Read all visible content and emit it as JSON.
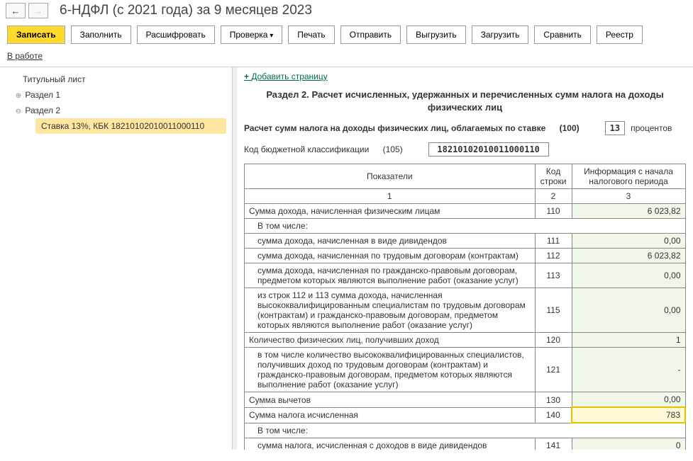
{
  "nav": {
    "back": "←",
    "forward": "→"
  },
  "title": "6-НДФЛ (с 2021 года) за 9 месяцев 2023",
  "toolbar": {
    "save": "Записать",
    "fill": "Заполнить",
    "decode": "Расшифровать",
    "check": "Проверка",
    "print": "Печать",
    "send": "Отправить",
    "export": "Выгрузить",
    "import": "Загрузить",
    "compare": "Сравнить",
    "registry": "Реестр"
  },
  "status": "В работе",
  "tree": {
    "title_page": "Титульный лист",
    "section1": "Раздел 1",
    "section2": "Раздел 2",
    "selected": "Ставка 13%, КБК 18210102010011000110"
  },
  "right": {
    "add_page": "Добавить страницу",
    "heading": "Раздел 2. Расчет исчисленных, удержанных и перечисленных сумм налога на доходы физических лиц",
    "calc_line": "Расчет сумм налога на доходы физических лиц, облагаемых по ставке",
    "calc_code": "(100)",
    "rate": "13",
    "percent_word": "процентов",
    "kbk_label": "Код бюджетной классификации",
    "kbk_code": "(105)",
    "kbk_value": "18210102010011000110",
    "headers": {
      "indicator": "Показатели",
      "code": "Код строки",
      "info": "Информация с начала налогового периода",
      "c1": "1",
      "c2": "2",
      "c3": "3"
    },
    "rows": [
      {
        "label": "Сумма дохода, начисленная физическим лицам",
        "code": "110",
        "val": "6 023,82"
      },
      {
        "label": "В том числе:",
        "sub": true
      },
      {
        "label": "сумма дохода, начисленная в виде дивидендов",
        "code": "111",
        "val": "0,00",
        "indent": true
      },
      {
        "label": "сумма дохода, начисленная по трудовым договорам (контрактам)",
        "code": "112",
        "val": "6 023,82",
        "indent": true
      },
      {
        "label": "сумма дохода, начисленная по гражданско-правовым договорам, предметом которых являются выполнение работ (оказание услуг)",
        "code": "113",
        "val": "0,00",
        "indent": true
      },
      {
        "label": "из строк 112 и 113 сумма дохода, начисленная высококвалифицированным специалистам по трудовым договорам (контрактам) и гражданско-правовым договорам, предметом которых являются выполнение работ (оказание услуг)",
        "code": "115",
        "val": "0,00",
        "indent": true
      },
      {
        "label": "Количество физических лиц, получивших доход",
        "code": "120",
        "val": "1"
      },
      {
        "label": "в том числе количество высококвалифицированных специалистов, получивших доход по трудовым договорам (контрактам) и гражданско-правовым договорам, предметом которых являются выполнение работ (оказание услуг)",
        "code": "121",
        "val": "-",
        "indent": true
      },
      {
        "label": "Сумма вычетов",
        "code": "130",
        "val": "0,00"
      },
      {
        "label": "Сумма налога исчисленная",
        "code": "140",
        "val": "783",
        "hl": true
      },
      {
        "label": "В том числе:",
        "sub": true
      },
      {
        "label": "сумма налога, исчисленная с доходов в виде дивидендов",
        "code": "141",
        "val": "0",
        "indent": true
      }
    ]
  }
}
